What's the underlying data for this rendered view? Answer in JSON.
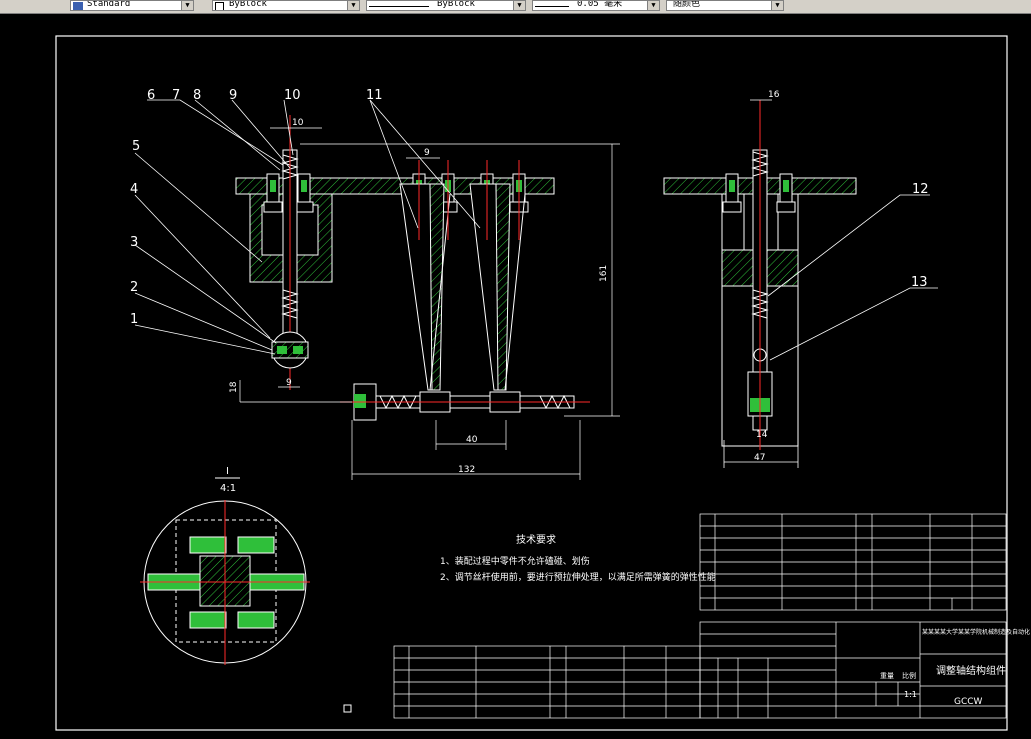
{
  "toolbar": {
    "text_style": "Standard",
    "linetype_layer": "ByBlock",
    "linetype": "ByBlock",
    "lineweight": "0.05 毫米",
    "color": "随颜色"
  },
  "drawing": {
    "item_numbers": [
      "1",
      "2",
      "3",
      "4",
      "5",
      "6",
      "7",
      "8",
      "9",
      "10",
      "11",
      "12",
      "13"
    ],
    "detail_label": "I",
    "detail_scale": "4:1",
    "tech_title": "技术要求",
    "tech_notes": [
      "1、装配过程中零件不允许磕碰、划伤",
      "2、调节丝杆使用前，要进行预拉伸处理，以满足所需弹簧的弹性性能"
    ],
    "dims": {
      "d10": "10",
      "d9a": "9",
      "d16": "16",
      "d161": "161",
      "d18": "18",
      "d9b": "9",
      "d40": "40",
      "d132": "132",
      "d47": "47",
      "d14": "14"
    },
    "title_block": {
      "name": "调整轴结构组件",
      "code": "GCCW",
      "scale": "1:1",
      "weight_label": "重量",
      "scale_label": "比例",
      "school": "某某某某大学某某学院机械制造及自动化"
    }
  }
}
